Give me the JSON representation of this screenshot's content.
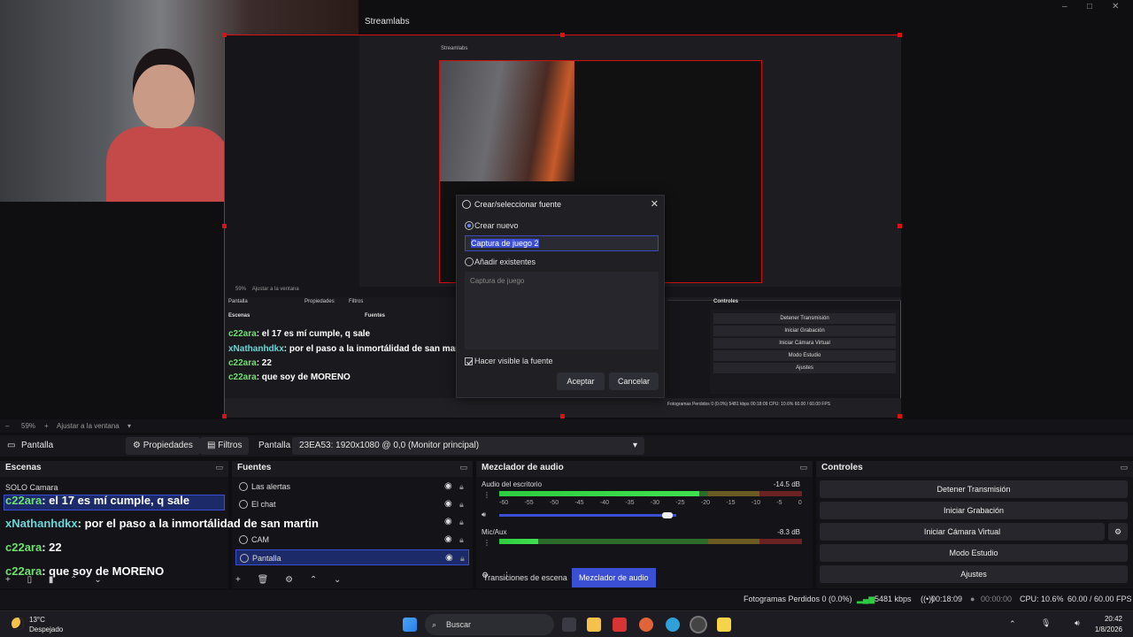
{
  "window": {
    "title": "Streamlabs",
    "controls": [
      "–",
      "□",
      "✕"
    ]
  },
  "preview": {
    "nested_title": "Streamlabs",
    "nested_chat": [
      {
        "user": "c22ara",
        "text": ": el 17 es mí cumple, q sale"
      },
      {
        "user": "xNathanhdkx",
        "text": ": por el paso a la inmortálidad de san martin"
      },
      {
        "user": "c22ara",
        "text": ": 22"
      },
      {
        "user": "c22ara",
        "text": ": que soy de MORENO"
      }
    ],
    "mini_bar_zoom": "59%",
    "mini_bar_fit": "Ajustar a la ventana",
    "mini_source": "Pantalla",
    "mini_props": "Propiedades",
    "mini_filters": "Filtros",
    "mini_scenes_label": "Escenas",
    "mini_sources_label": "Fuentes",
    "mini_controls_label": "Controles",
    "mini_controls": [
      "Detener Transmisión",
      "Iniciar Grabación",
      "Iniciar Cámara Virtual",
      "Modo Estudio",
      "Ajustes"
    ],
    "mini_stats": "Fotogramas Perdidos 0 (0.0%)   5481 kbps   00:18:09   CPU: 10.6%   60.00 / 60.00 FPS"
  },
  "dialog": {
    "title": "Crear/seleccionar fuente",
    "create_new_label": "Crear nuevo",
    "name_value": "Captura de juego 2",
    "add_existing_label": "Añadir existentes",
    "existing_items": [
      "Captura de juego"
    ],
    "make_visible_label": "Hacer visible la fuente",
    "accept_label": "Aceptar",
    "cancel_label": "Cancelar"
  },
  "zoombar": {
    "zoom": "59%",
    "fit": "Ajustar a la ventana"
  },
  "sourcebar": {
    "source_name": "Pantalla",
    "properties_label": "Propiedades",
    "filters_label": "Filtros",
    "display_label": "Pantalla",
    "display_value": "23EA53: 1920x1080 @ 0,0 (Monitor principal)"
  },
  "scenes": {
    "title": "Escenas",
    "items": [
      "SOLO Camara"
    ]
  },
  "overlay_chat": [
    {
      "user": "c22ara",
      "text": ": el 17 es mí cumple, q sale"
    },
    {
      "user": "xNathanhdkx",
      "text": ": por el paso a la inmortálidad de san martin"
    },
    {
      "user": "c22ara",
      "text": ": 22"
    },
    {
      "user": "c22ara",
      "text": ": que soy de MORENO"
    }
  ],
  "sources": {
    "title": "Fuentes",
    "items": [
      {
        "label": "Las alertas"
      },
      {
        "label": "El chat"
      },
      {
        "label": ""
      },
      {
        "label": "CAM"
      },
      {
        "label": "Pantalla"
      }
    ]
  },
  "mixer": {
    "title": "Mezclador de audio",
    "channels": [
      {
        "name": "Audio del escritorio",
        "db": "-14.5 dB",
        "level_pct": 0.66
      },
      {
        "name": "Mic/Aux",
        "db": "-8.3 dB",
        "level_pct": 0.13
      }
    ],
    "scale": [
      "-60",
      "-55",
      "-50",
      "-45",
      "-40",
      "-35",
      "-30",
      "-25",
      "-20",
      "-15",
      "-10",
      "-5",
      "0"
    ],
    "tabs": [
      "Transiciones de escena",
      "Mezclador de audio"
    ]
  },
  "controls": {
    "title": "Controles",
    "buttons": [
      "Detener Transmisión",
      "Iniciar Grabación",
      "Iniciar Cámara Virtual",
      "Modo Estudio",
      "Ajustes"
    ]
  },
  "status": {
    "dropped": "Fotogramas Perdidos 0 (0.0%)",
    "bitrate": "5481 kbps",
    "stream_time": "00:18:09",
    "rec_time": "00:00:00",
    "cpu": "CPU: 10.6%",
    "fps": "60.00 / 60.00 FPS"
  },
  "taskbar": {
    "temp": "13°C",
    "weather": "Despejado",
    "search_placeholder": "Buscar",
    "time": "20:42",
    "date": "1/8/2026"
  }
}
